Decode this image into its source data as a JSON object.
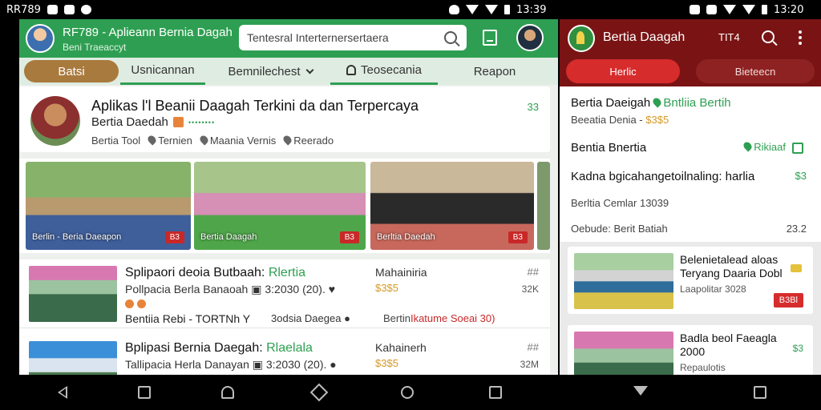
{
  "statusbar": {
    "left_text": "RR789",
    "mid_time": "13:39",
    "right_time": "13:20"
  },
  "left_app": {
    "header": {
      "title": "RF789 - Aplieann Bernia Dagah",
      "subtitle": "Beni Traeaccyt",
      "search_value": "Tentesral Interternersertaera"
    },
    "tabs": {
      "items": [
        {
          "label": "Batsi"
        },
        {
          "label": "Usnicannan"
        },
        {
          "label": "Bemnilechest"
        },
        {
          "label": "Teosecania"
        },
        {
          "label": "Reapon"
        }
      ]
    },
    "profile": {
      "title": "Aplikas  l'l Beanii Daagah Terkini da dan Terpercaya",
      "name": "Bertia Daedah",
      "dots": "••••••••",
      "meta1": "Bertia Tool",
      "meta2": "Ternien",
      "meta3": "Maania Vernis",
      "meta4": "Reerado",
      "count": "33"
    },
    "gallery": {
      "items": [
        {
          "caption": "Berlin - Beria Daeapon",
          "tag": "B3"
        },
        {
          "caption": "Bertia Daagah",
          "tag": "B3"
        },
        {
          "caption": "Berltia Daedah",
          "tag": "B3"
        }
      ]
    },
    "news": {
      "items": [
        {
          "title": "Splipaori deoia Butbaah:",
          "title_green": "Rlertia",
          "subtitle": "Pollpacia Berla Banaoah",
          "sub_meta": "3:2030 (20).",
          "footer": "Bentiia Rebi - TORTNh Y",
          "location": "3odsia Daegea",
          "extra": "Bertin",
          "extra_red": "Ikatume Soeai 30)",
          "col": "Mahainiria",
          "price": "$3$5",
          "ico1": "##",
          "ico2": "32K"
        },
        {
          "title": "Bplipasi Bernia Daegah:",
          "title_green": "Rlaelala",
          "subtitle": "Tallipacia Herla Danayan",
          "sub_meta": "3:2030 (20).",
          "col": "Kahainerh",
          "price": "$3$5",
          "ico1": "##",
          "ico2": "32M"
        }
      ]
    }
  },
  "right_app": {
    "header": {
      "title": "Bertia Daagah",
      "code": "TIT4"
    },
    "tabs": {
      "active": "Herlic",
      "inactive": "Bieteecn"
    },
    "card": {
      "line1": "Bertia Daeigah",
      "line1_green": "Bntliia Bertih",
      "line2": "Beeatia Denia -",
      "line2_price": "$3$5",
      "line3": "Bentia Bnertia",
      "line3_right": "Rikiaaf",
      "line4": "Kadna bgicahangetoilnaling: harlia",
      "line4_right": "$3",
      "line5": "Berltia Cemlar 13039",
      "line6": "Oebude: Berit Batiah",
      "line6_right": "23.2"
    },
    "news": {
      "items": [
        {
          "title": "Belenietalead aloas Teryang Daaria Dobl",
          "subtitle": "Laapolitar 3028",
          "badge": "B3Bl"
        },
        {
          "title": "Badla beol Faeagla 2000",
          "subtitle": "Repaulotis",
          "val": "$3"
        }
      ]
    }
  }
}
